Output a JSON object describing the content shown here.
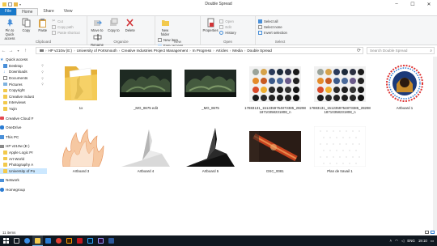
{
  "window": {
    "title": "Double Spread",
    "controls": [
      "minimize",
      "maximize",
      "close"
    ]
  },
  "ribbon_tabs": [
    "File",
    "Home",
    "Share",
    "View"
  ],
  "ribbon": {
    "clipboard": {
      "label": "Clipboard",
      "pin": "Pin to Quick access",
      "copy": "Copy",
      "paste": "Paste",
      "cut": "Cut",
      "copy_path": "Copy path",
      "paste_shortcut": "Paste shortcut"
    },
    "organize": {
      "label": "Organize",
      "move_to": "Move to",
      "copy_to": "Copy to",
      "delete": "Delete",
      "rename": "Rename"
    },
    "new": {
      "label": "New",
      "new_folder": "New folder",
      "new_item": "New item",
      "easy_access": "Easy access"
    },
    "open": {
      "label": "Open",
      "properties": "Properties",
      "open": "Open",
      "edit": "Edit",
      "history": "History"
    },
    "select": {
      "label": "Select",
      "select_all": "Select all",
      "select_none": "Select none",
      "invert_selection": "Invert selection"
    }
  },
  "address": {
    "crumbs": [
      "HP v210w (E:)",
      "University of Portsmouth",
      "Creative Industries Project Management",
      "In Progress",
      "Articles",
      "Media",
      "Double Spread"
    ],
    "search_placeholder": "Search Double Spread"
  },
  "nav": {
    "quick_access_label": "Quick access",
    "quick_access": [
      "Desktop",
      "Downloads",
      "Documents",
      "Pictures",
      "Copyright",
      "Creative Indust",
      "Interviews",
      "Yujin"
    ],
    "others": [
      "Creative Cloud F",
      "OneDrive",
      "This PC",
      "HP v210w (E:)"
    ],
    "drive_children": [
      "Apple Logic Pr",
      "Art World",
      "Photography A",
      "University of Po"
    ],
    "network": [
      "Network",
      "Homegroup"
    ]
  },
  "files": [
    {
      "name": "1x",
      "kind": "folder"
    },
    {
      "name": "_MG_8675 edit",
      "kind": "photo-dark"
    },
    {
      "name": "_MG_8675",
      "kind": "photo-dark"
    },
    {
      "name": "17883131_1512359754873385_2829818710358231808_n",
      "kind": "palette"
    },
    {
      "name": "17883131_1512359754873385_2829818710358231808_n",
      "kind": "palette"
    },
    {
      "name": "Artboard 1",
      "kind": "badge"
    },
    {
      "name": "Artboard 3",
      "kind": "flame"
    },
    {
      "name": "Artboard 4",
      "kind": "shard-light"
    },
    {
      "name": "Artboard 5",
      "kind": "shard-dark"
    },
    {
      "name": "DSC_0081",
      "kind": "photo-rust"
    },
    {
      "name": "Plan de travail 1",
      "kind": "dots"
    }
  ],
  "status": {
    "item_count": "11 items"
  },
  "taskbar": {
    "language": "ENG",
    "time": "19:10"
  },
  "colors": {
    "file_tab": "#1979ca",
    "selection": "#cce8ff",
    "taskbar": "#101820",
    "folder": "#f2c94c"
  }
}
